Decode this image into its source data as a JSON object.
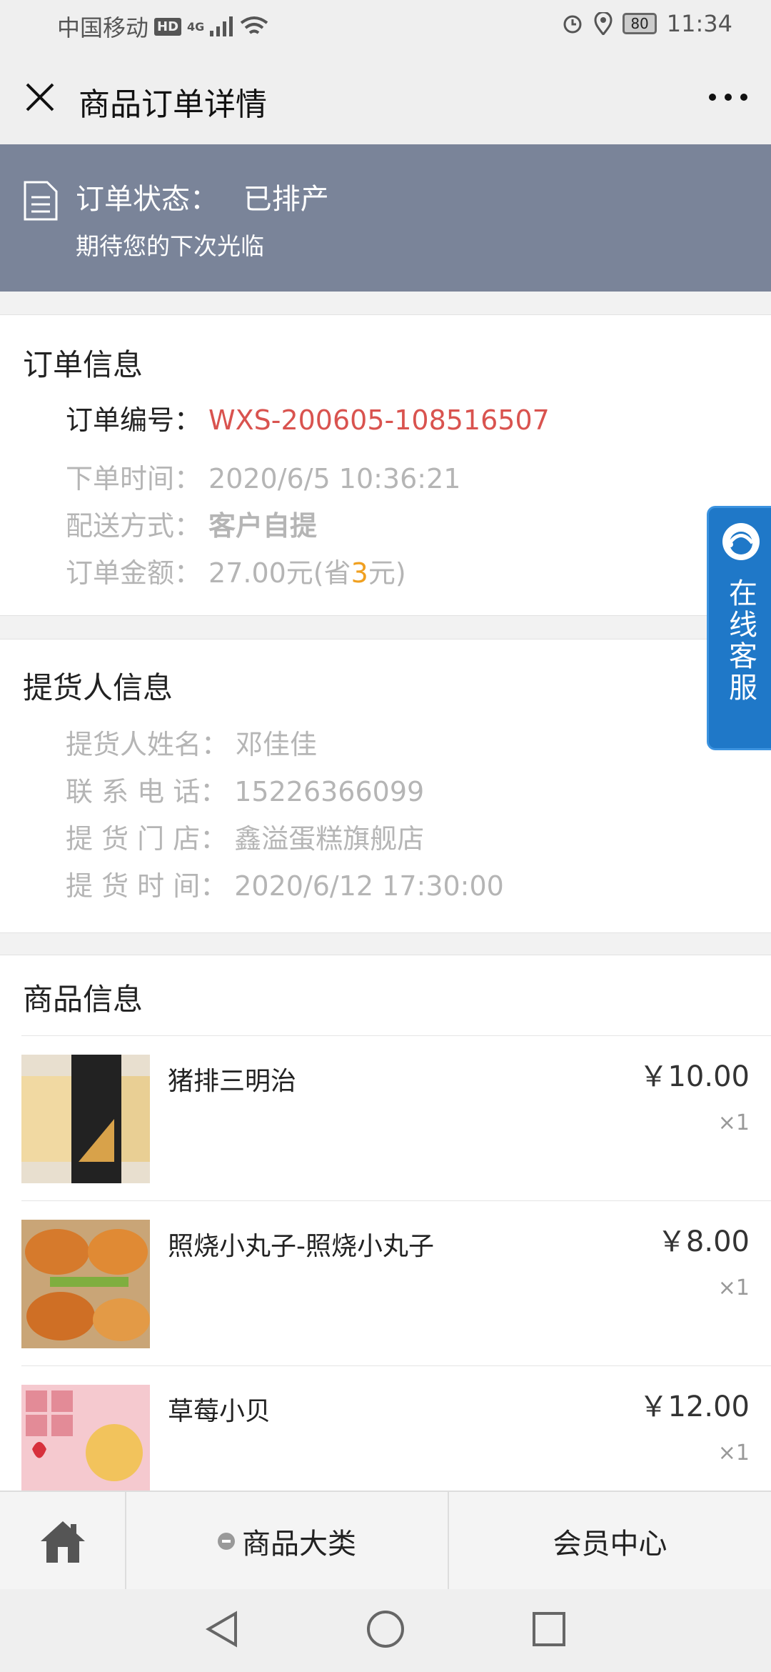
{
  "status_bar": {
    "carrier": "中国移动",
    "hd": "HD",
    "network": "4G",
    "battery": "80",
    "time": "11:34"
  },
  "nav": {
    "title": "商品订单详情"
  },
  "banner": {
    "status_label": "订单状态：",
    "status_value": "已排产",
    "subtitle": "期待您的下次光临"
  },
  "order_info": {
    "heading": "订单信息",
    "order_no_label": "订单编号：",
    "order_no": "WXS-200605-108516507",
    "time_label": "下单时间：",
    "time": "2020/6/5 10:36:21",
    "delivery_label": "配送方式：",
    "delivery": "客户自提",
    "amount_label": "订单金额：",
    "amount_prefix": "27.00元(省",
    "amount_saved": "3",
    "amount_suffix": "元)"
  },
  "pickup_info": {
    "heading": "提货人信息",
    "name_label": "提货人姓名：",
    "name": "邓佳佳",
    "phone_label": "联 系 电 话：",
    "phone": "15226366099",
    "store_label": "提 货 门 店：",
    "store": "鑫溢蛋糕旗舰店",
    "time_label": "提 货 时 间：",
    "time": "2020/6/12 17:30:00"
  },
  "products": {
    "heading": "商品信息",
    "items": [
      {
        "name": "猪排三明治",
        "price": "￥10.00",
        "qty": "×1",
        "thumb_color": "#2b2b2b"
      },
      {
        "name": "照烧小丸子-照烧小丸子",
        "price": "￥8.00",
        "qty": "×1",
        "thumb_color": "#d9853a"
      },
      {
        "name": "草莓小贝",
        "price": "￥12.00",
        "qty": "×1",
        "thumb_color": "#f4c2c8"
      }
    ]
  },
  "service": {
    "label": "在线客服"
  },
  "tabbar": {
    "category": "商品大类",
    "member": "会员中心"
  },
  "colors": {
    "banner": "#7a8499",
    "order_no": "#d9534f",
    "saved": "#f0a020",
    "service": "#1f78c8"
  }
}
